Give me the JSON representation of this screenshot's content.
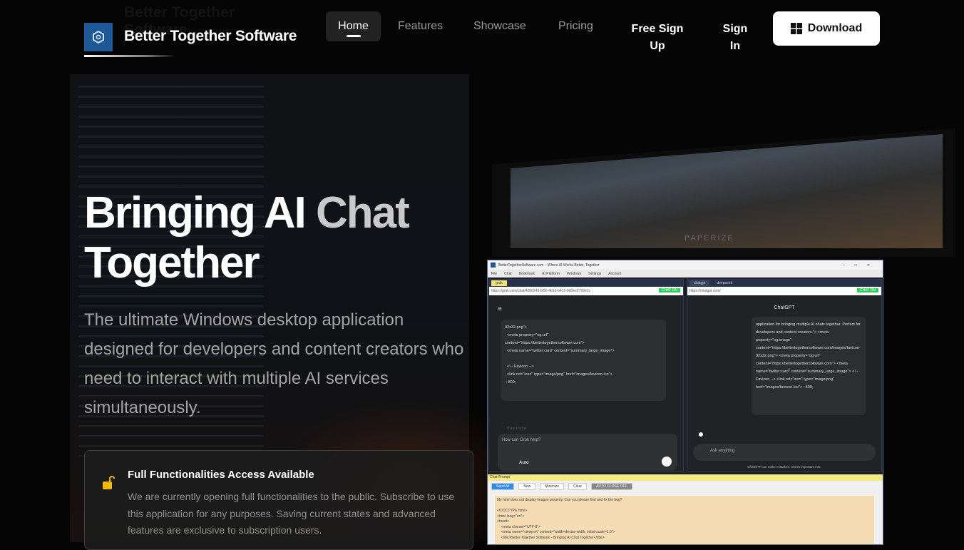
{
  "brand": {
    "name": "Better Together Software"
  },
  "nav": {
    "items": [
      {
        "label": "Home",
        "active": true
      },
      {
        "label": "Features"
      },
      {
        "label": "Showcase"
      },
      {
        "label": "Pricing"
      }
    ],
    "free_signup": "Free Sign Up",
    "sign_in": "Sign In",
    "download": "Download"
  },
  "hero": {
    "title_part1": "Bringing AI",
    "title_part2": "Chat",
    "title_part3": "Together",
    "subtitle": "The ultimate Windows desktop application designed for developers and content creators who need to interact with multiple AI services simultaneously."
  },
  "notice": {
    "title": "Full Functionalities Access Available",
    "body": "We are currently opening full functionalities to the public. Subscribe to use this application for any purposes. Saving current states and advanced features are exclusive to subscription users."
  },
  "app_preview": {
    "window_title": "BetterTogetherSoftware.com – Where AI Works Better, Together",
    "menu": [
      "File",
      "Chat",
      "Bookmark",
      "AI Platform",
      "Windows",
      "Settings",
      "Account"
    ],
    "left_tab": "grok",
    "left_url": "https://grok.com/chat/4056243-bf56-4b1d-b415-9d0ee2793e1c",
    "chat_on": "CHAT ON",
    "left_code": "32x32.png\">\n  <meta property=\"og:url\"\ncontent=\"https://bettertogethersoftware.com\">\n  <meta name=\"twitter:card\" content=\"summary_large_image\">\n\n  <!-- Favicon -->\n  <link rel=\"icon\" type=\"image/png\" href=\"images/favicon.ico\">\n : 800;",
    "grok_placeholder": "How can Grok help?",
    "grok_mode": "Auto",
    "think_harder": "Think Harder",
    "right_tabs": [
      "chatgpt",
      "deepseek"
    ],
    "right_url": "https://chatgpt.com/",
    "chatgpt_title": "ChatGPT",
    "right_code": "application for bringing multiple AI chats together. Perfect for developers and content creators.\">   <meta property=\"og:image\" content=\"https://bettertogethersoftware.com/images/favicon-32x32.png\">   <meta property=\"og:url\" content=\"https://bettertogethersoftware.com\">   <meta name=\"twitter:card\" content=\"summary_large_image\">   <!-- Favicon -->   <link rel=\"icon\" type=\"image/png\" href=\"images/favicon.ico\"> : 800;",
    "chatgpt_placeholder": "Ask anything",
    "chatgpt_disclaimer": "ChatGPT can make mistakes. Check important info.",
    "prompt_title": "Chat Prompt",
    "prompt_buttons": [
      "Send All",
      "New",
      "Minimize",
      "Clear",
      "AUTO CLOSE OFF"
    ],
    "prompt_text": "My html does not display images properly. Can you please find and fix the bug?\n\n<!DOCTYPE html>\n<html lang=\"en\">\n<head>\n    <meta charset=\"UTF-8\">\n    <meta name=\"viewport\" content=\"width=device-width, initial-scale=1.0\">\n    <title>Better Together Software - Bringing AI Chat Together</title>"
  },
  "background": {
    "watermark": "PAPERIZE"
  },
  "colors": {
    "logo": "#1d5796",
    "lock": "#f5b800",
    "bg": "#050505"
  }
}
